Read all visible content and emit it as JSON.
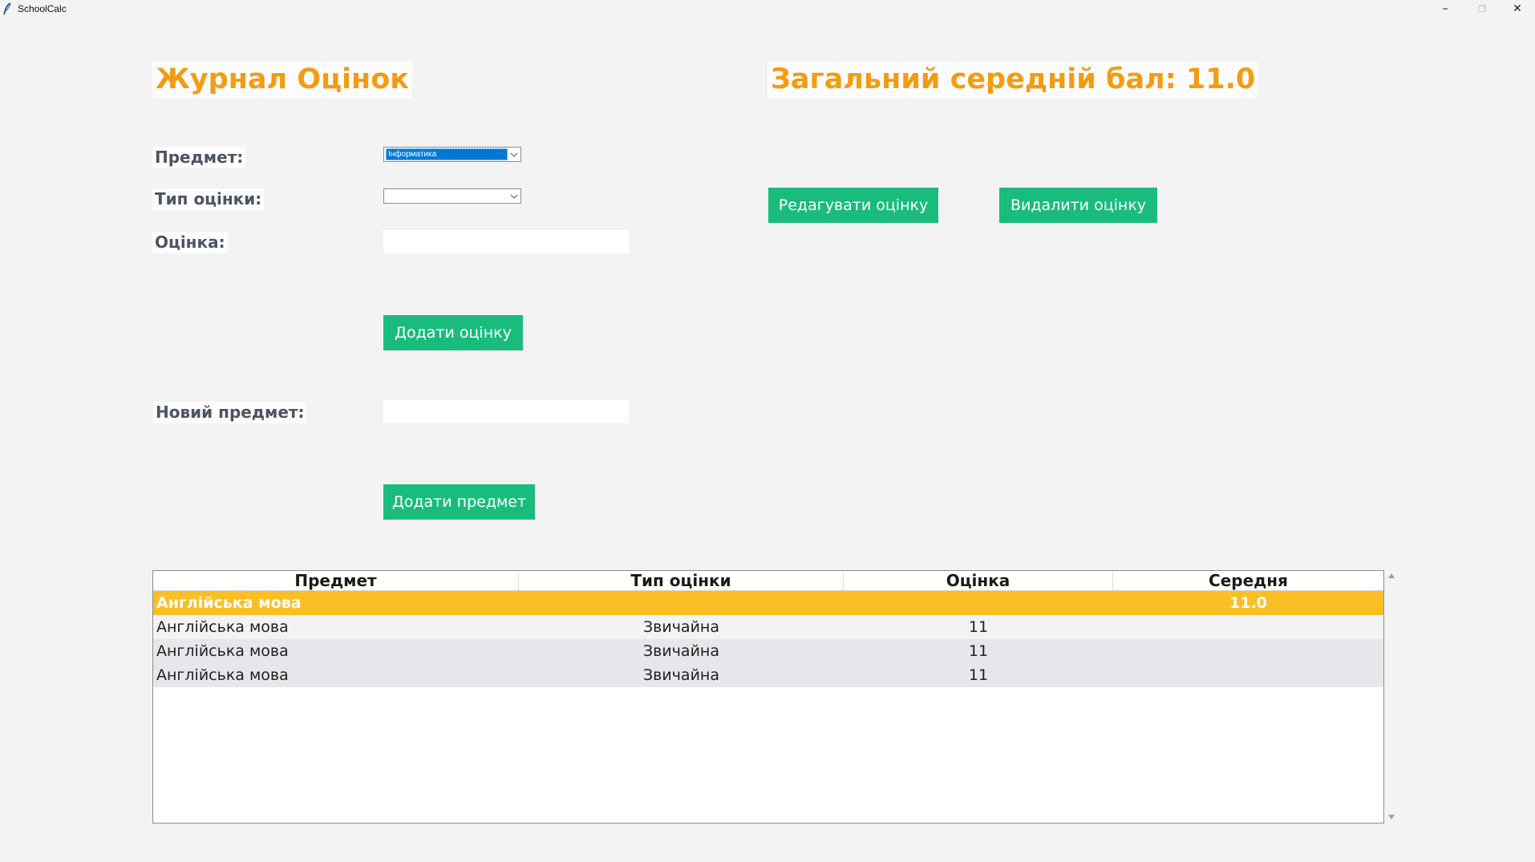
{
  "window": {
    "title": "SchoolCalc",
    "minimize_glyph": "–",
    "restore_glyph": "❐",
    "close_glyph": "✕"
  },
  "header": {
    "title": "Журнал Оцінок",
    "average_label": "Загальний середній бал: 11.0"
  },
  "form": {
    "subject_label": "Предмет:",
    "subject_value": "Інформатика",
    "grade_type_label": "Тип оцінки:",
    "grade_type_value": "",
    "grade_label": "Оцінка:",
    "grade_value": "",
    "add_grade_button": "Додати оцінку",
    "new_subject_label": "Новий предмет:",
    "new_subject_value": "",
    "add_subject_button": "Додати предмет"
  },
  "actions": {
    "edit_button": "Редагувати оцінку",
    "delete_button": "Видалити оцінку"
  },
  "table": {
    "columns": [
      "Предмет",
      "Тип оцінки",
      "Оцінка",
      "Середня"
    ],
    "group_row": {
      "subject": "Англійська мова",
      "type": "",
      "grade": "",
      "average": "11.0"
    },
    "rows": [
      {
        "subject": "Англійська мова",
        "type": "Звичайна",
        "grade": "11",
        "average": ""
      },
      {
        "subject": "Англійська мова",
        "type": "Звичайна",
        "grade": "11",
        "average": ""
      },
      {
        "subject": "Англійська мова",
        "type": "Звичайна",
        "grade": "11",
        "average": ""
      }
    ]
  },
  "colors": {
    "accent_orange": "#f39c12",
    "button_green": "#1abc7e",
    "group_row_yellow": "#fbbf24",
    "selection_blue": "#0078d7"
  },
  "icons": {
    "app": "feather-icon",
    "dropdown": "chevron-down-icon",
    "scroll_up": "scroll-up-arrow-icon",
    "scroll_down": "scroll-down-arrow-icon"
  }
}
